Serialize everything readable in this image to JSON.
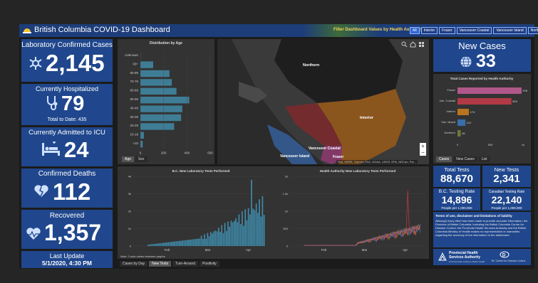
{
  "header": {
    "title": "British Columbia COVID-19 Dashboard",
    "filter_label": "Filter Dashboard Values by Health Authority:",
    "filters": [
      "All",
      "Interior",
      "Fraser",
      "Vancouver Coastal",
      "Vancouver Island",
      "Northern"
    ],
    "active_filter": "All"
  },
  "cards": {
    "lab": {
      "title": "Laboratory Confirmed Cases",
      "value": "2,145"
    },
    "hosp": {
      "title": "Currently Hospitalized",
      "value": "79",
      "sub": "Total to Date: 435"
    },
    "icu": {
      "title": "Currently Admitted to ICU",
      "value": "24"
    },
    "deaths": {
      "title": "Confirmed Deaths",
      "value": "112"
    },
    "recovered": {
      "title": "Recovered",
      "value": "1,357"
    },
    "update": {
      "title": "Last Update",
      "value": "5/1/2020, 4:30 PM"
    },
    "newcases": {
      "title": "New Cases",
      "value": "33"
    }
  },
  "age_chart": {
    "title": "Distribution by Age",
    "tabs": [
      "Age",
      "Sex"
    ],
    "active_tab": "Age"
  },
  "map": {
    "labels": [
      "Northern",
      "Interior",
      "Vancouver Coastal",
      "Vancouver Island",
      "Fraser"
    ],
    "attribution": "Esri, HERE, Garmin, FAO, NOAA, USGS, EPA, NRCan, Par..."
  },
  "ha_chart": {
    "title": "Total Cases Reported by Health Authority",
    "tabs": [
      "Cases",
      "New Cases",
      "List"
    ],
    "active_tab": "Cases"
  },
  "tests_chart": {
    "title": "B.C. New Laboratory Tests Performed",
    "note": "Note: Y-axis varies between graphs"
  },
  "ha_tests_chart": {
    "title": "Health Authority New Laboratory Tests Performed"
  },
  "bottom_tabs": {
    "items": [
      "Cases by Day",
      "New Tests",
      "Turn-Around",
      "Positivity"
    ],
    "active": "New Tests"
  },
  "tests": {
    "total": {
      "title": "Total Tests",
      "value": "88,670"
    },
    "new": {
      "title": "New Tests",
      "value": "2,341"
    },
    "bc_rate": {
      "title": "B.C. Testing Rate",
      "value": "14,896",
      "sub": "People per 1,000,000"
    },
    "ca_rate": {
      "title": "Canadian Testing Rate",
      "value": "22,140",
      "sub": "People per 1,000,000"
    }
  },
  "disclaimer": {
    "title": "Terms of use, disclaimer and limitations of liability",
    "body": "Although every effort has been made to provide accurate information, the Province of British Columbia, including the British Columbia Centre for Disease Control, the Provincial Health Services Authority and the British Columbia Ministry of Health makes no representation or warranties regarding the accuracy of the information in the dashboard"
  },
  "footer": {
    "phsa": "Provincial Health Services Authority",
    "phsa_sub": "Province-wide solutions. Better health.",
    "bccdc": "BC Centre for Disease Control"
  },
  "chart_data": [
    {
      "type": "bar",
      "title": "Distribution by Age",
      "categories": [
        "Unknown",
        "90+",
        "80-89",
        "70-79",
        "60-69",
        "50-59",
        "40-49",
        "30-39",
        "20-29",
        "10-19",
        "<10"
      ],
      "values": [
        2,
        110,
        250,
        270,
        310,
        420,
        360,
        350,
        290,
        30,
        20
      ],
      "xlim": [
        0,
        600
      ],
      "xticks": [
        "0",
        "200",
        "400",
        "600"
      ]
    },
    {
      "type": "bar",
      "title": "Total Cases Reported by Health Authority",
      "categories": [
        "Fraser",
        "Van. Coastal",
        "Interior",
        "Van. Island",
        "Northern"
      ],
      "values": [
        978,
        823,
        174,
        121,
        49
      ],
      "colors": [
        "#b0578a",
        "#b23a46",
        "#b8741f",
        "#3a6ea8",
        "#6c7a3a"
      ],
      "xlim": [
        0,
        1000
      ],
      "xticks": [
        "0",
        "500",
        "1k"
      ]
    },
    {
      "type": "bar",
      "title": "B.C. New Laboratory Tests Performed",
      "x": [
        "Feb",
        "Mar",
        "Apr"
      ],
      "yticks": [
        "0",
        "1k",
        "2k",
        "3k",
        "4k"
      ],
      "ylim": [
        0,
        4000
      ]
    },
    {
      "type": "area",
      "title": "Health Authority New Laboratory Tests Performed",
      "x": [
        "Feb",
        "Mar",
        "Apr"
      ],
      "yticks": [
        "0",
        "500",
        "1k",
        "1.5k",
        "2k"
      ],
      "ylim": [
        0,
        2000
      ]
    }
  ]
}
